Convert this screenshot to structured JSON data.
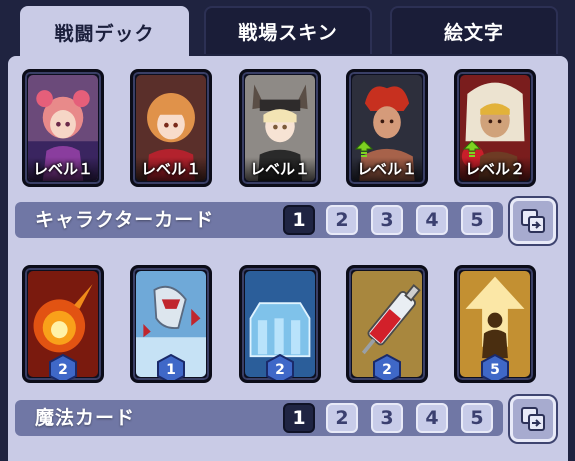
{
  "tabs": [
    {
      "label": "戦闘デック",
      "active": true
    },
    {
      "label": "戦場スキン",
      "active": false
    },
    {
      "label": "絵文字",
      "active": false
    }
  ],
  "character_section": {
    "title": "キャラクターカード",
    "cards": [
      {
        "level": "レベル１",
        "upgrade": false,
        "art": "pink-haired-girl"
      },
      {
        "level": "レベル１",
        "upgrade": false,
        "art": "orange-haired-girl"
      },
      {
        "level": "レベル１",
        "upgrade": false,
        "art": "fox-ear-girl"
      },
      {
        "level": "レベル１",
        "upgrade": true,
        "art": "red-haired-fighter"
      },
      {
        "level": "レベル２",
        "upgrade": true,
        "art": "boxer-hooded-man"
      }
    ],
    "decks": [
      "1",
      "2",
      "3",
      "4",
      "5"
    ],
    "active_deck": "1"
  },
  "magic_section": {
    "title": "魔法カード",
    "cards": [
      {
        "cost": "2",
        "art": "fireball"
      },
      {
        "cost": "1",
        "art": "shark-missiles"
      },
      {
        "cost": "2",
        "art": "ice-wall"
      },
      {
        "cost": "2",
        "art": "syringe"
      },
      {
        "cost": "5",
        "art": "power-up"
      }
    ],
    "decks": [
      "1",
      "2",
      "3",
      "4",
      "5"
    ],
    "active_deck": "1"
  },
  "colors": {
    "accent": "#1f2442",
    "panel": "#c9cbe6",
    "bar": "#7077a5",
    "upgrade_arrow": "#7ed321"
  }
}
